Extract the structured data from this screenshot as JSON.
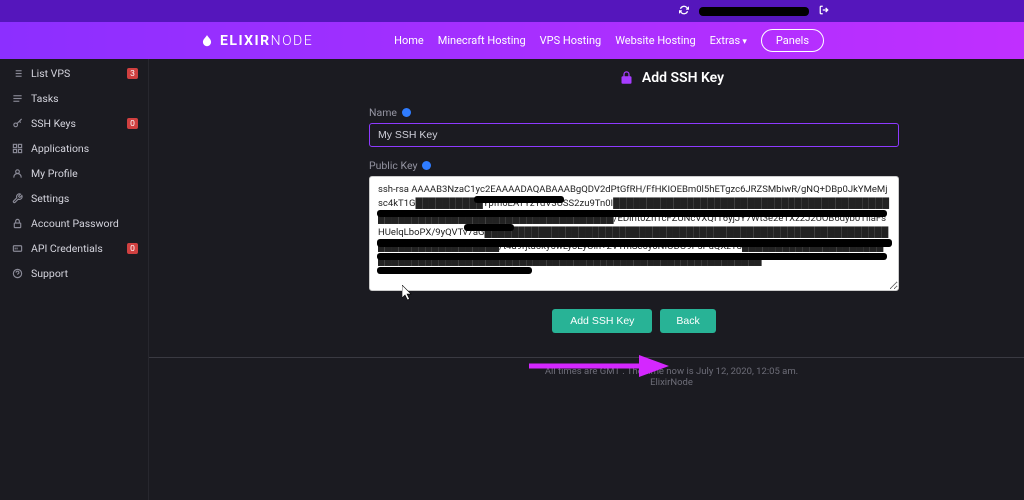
{
  "brand": {
    "bold": "ELIXIR",
    "light": "NODE"
  },
  "nav": {
    "links": [
      {
        "label": "Home"
      },
      {
        "label": "Minecraft Hosting"
      },
      {
        "label": "VPS Hosting"
      },
      {
        "label": "Website Hosting"
      },
      {
        "label": "Extras",
        "dropdown": true
      }
    ],
    "panels": "Panels"
  },
  "sidebar": {
    "items": [
      {
        "icon": "list",
        "label": "List VPS",
        "badge": "3"
      },
      {
        "icon": "tasks",
        "label": "Tasks"
      },
      {
        "icon": "key",
        "label": "SSH Keys",
        "badge": "0"
      },
      {
        "icon": "apps",
        "label": "Applications"
      },
      {
        "icon": "profile",
        "label": "My Profile"
      },
      {
        "icon": "wrench",
        "label": "Settings"
      },
      {
        "icon": "lock",
        "label": "Account Password"
      },
      {
        "icon": "api",
        "label": "API Credentials",
        "badge": "0"
      },
      {
        "icon": "support",
        "label": "Support"
      }
    ]
  },
  "page": {
    "title": "Add SSH Key",
    "name_label": "Name",
    "name_value": "My SSH Key",
    "publickey_label": "Public Key",
    "key_value": "ssh-rsa AAAAB3NzaC1yc2EAAAADAQABAAABgQDV2dPtGfRH/FfHKIOEBm0l5hETgzc6JRZSMbIwR/gNQ+DBp0JkYMeMjsc4kT1G██████████Ypfh6EATYzYdV3USS2zu9Tn0I████████████████████████████████████████████████████████████████████████████/EDirit0ZhTcFZUNcVXQfT6yjJY7Wt3e2eTXz2J2UOB6dyb0TIlaFsHUelqLboPX/9yQVTv7aG██████████████████████████████████████████████████████████████████████████████/t4a9rjta6ky6wLyoEyOln+2VYrnSc6y0NIODO9PsPuQXzT8██████████████████████████████████████████████████████████████████████████████",
    "add_button": "Add SSH Key",
    "back_button": "Back"
  },
  "footer": {
    "line1": "All times are GMT . The time now is July 12, 2020, 12:05 am.",
    "line2": "ElixirNode"
  },
  "colors": {
    "accent_purple": "#8c2fff",
    "accent_teal": "#28b396",
    "badge_red": "#d04040"
  }
}
